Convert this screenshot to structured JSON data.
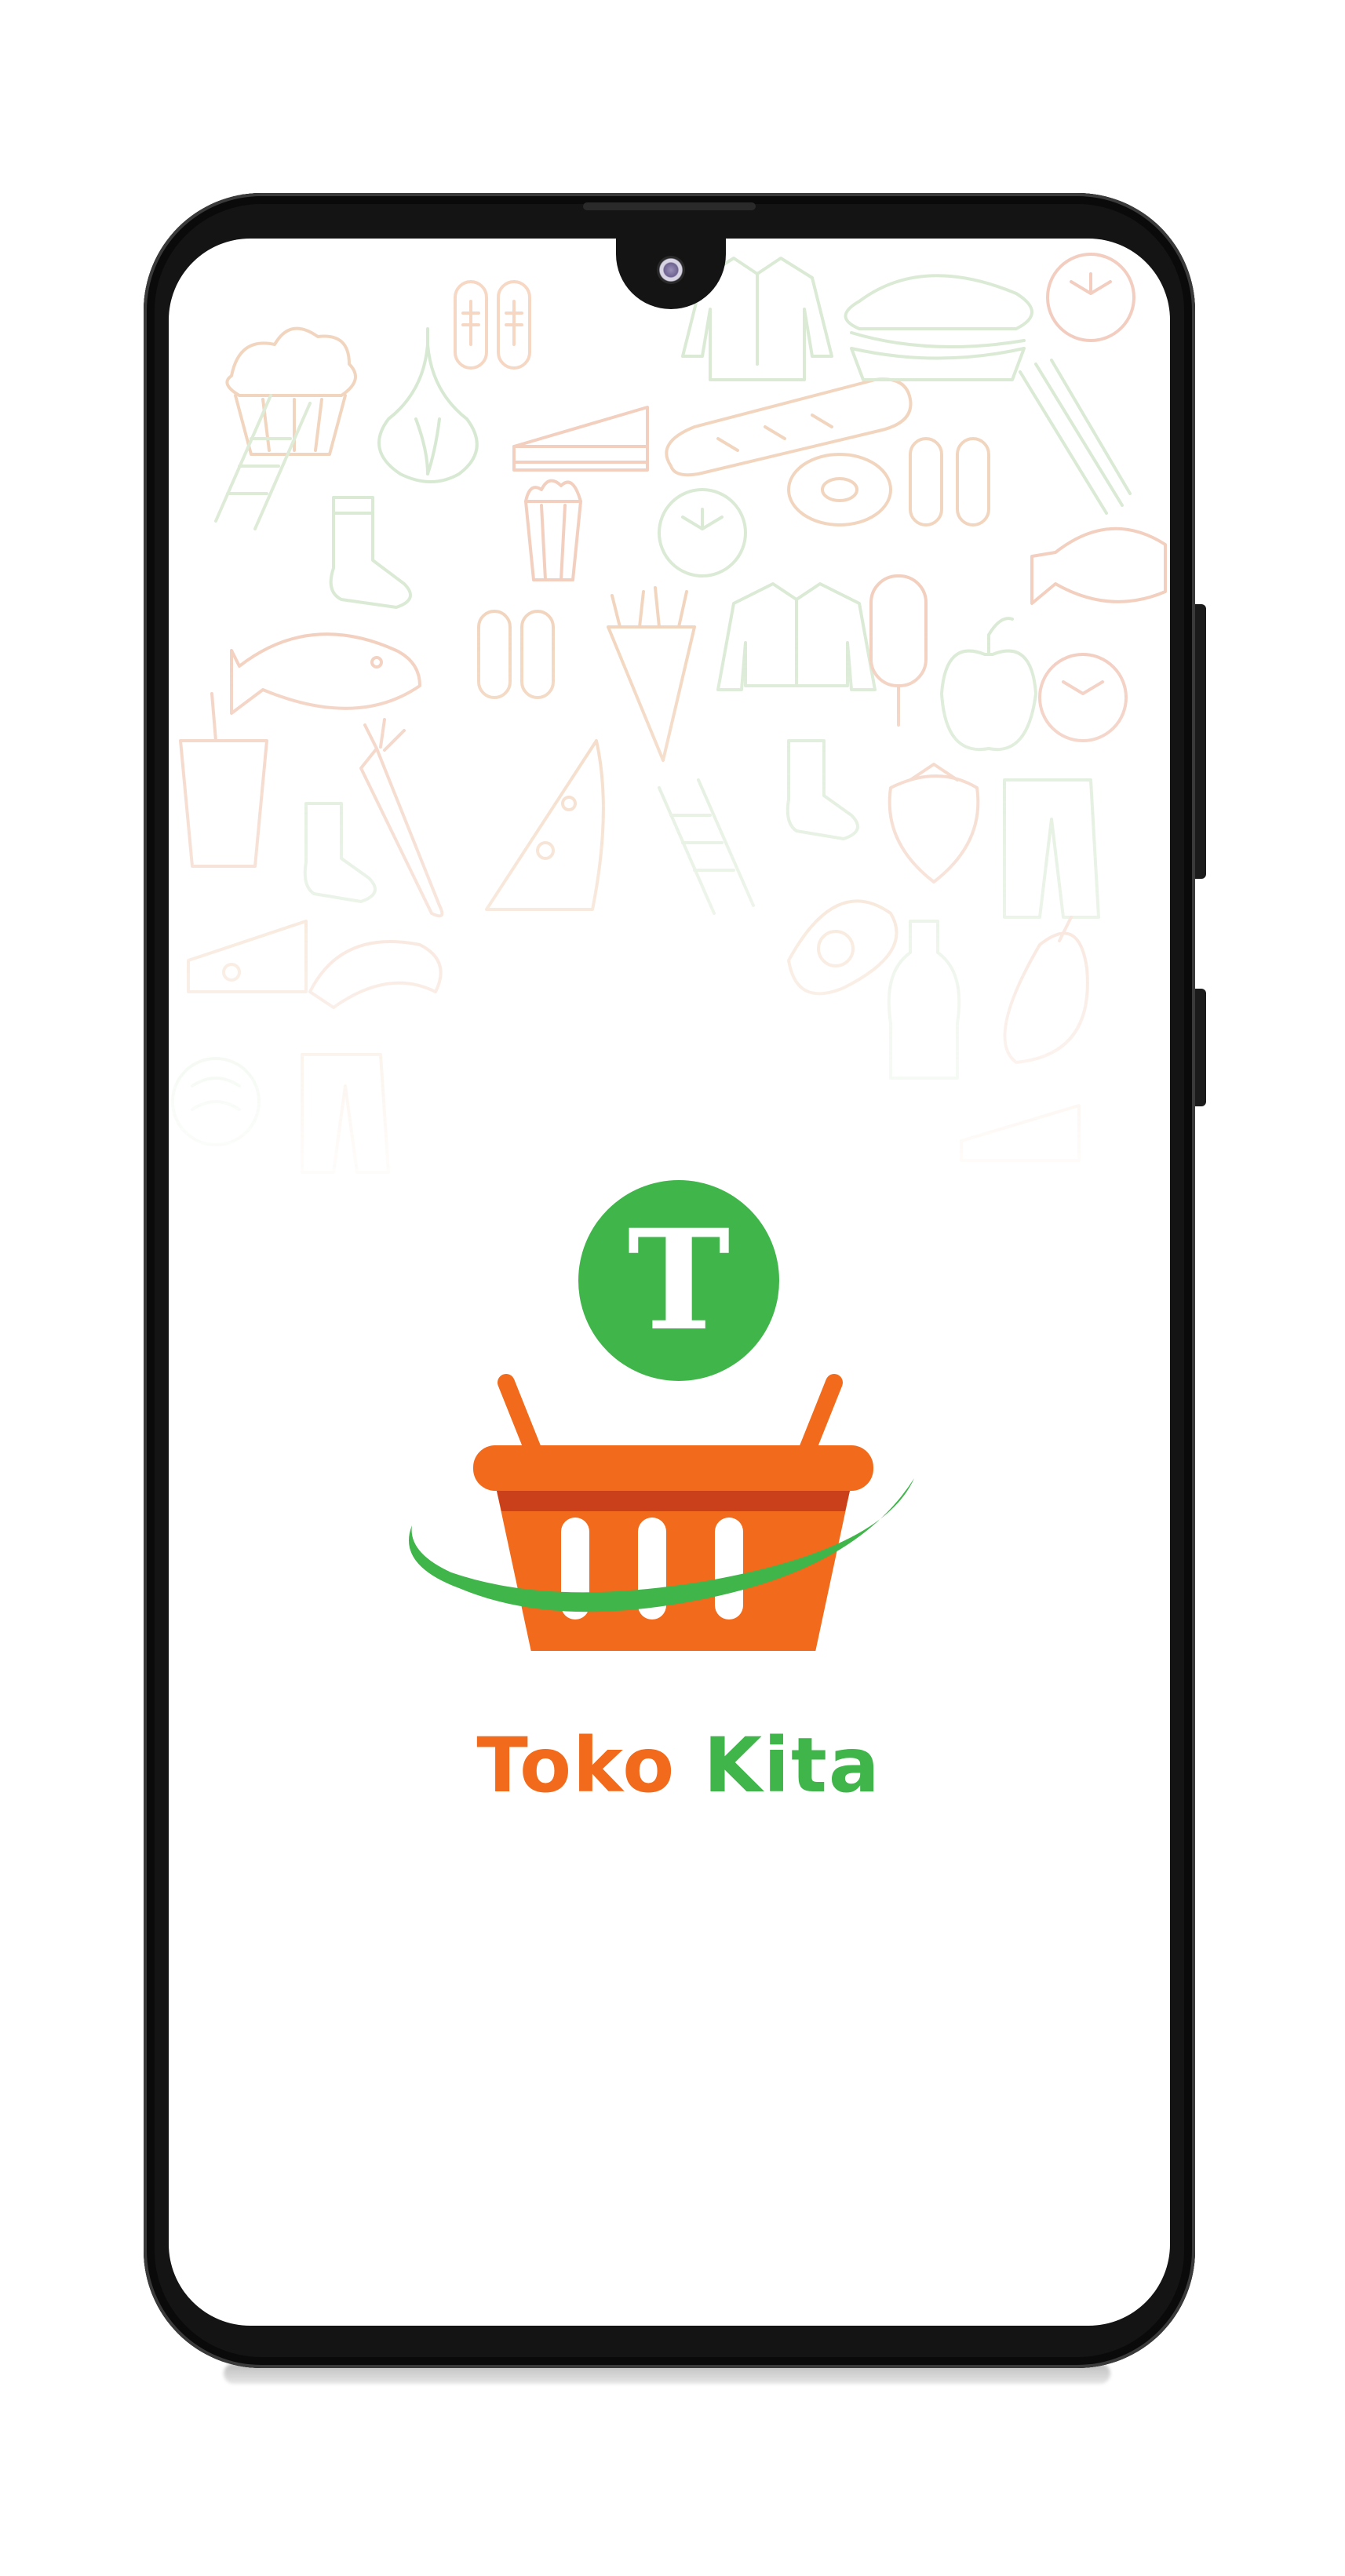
{
  "app": {
    "brand_part_1": "Toko",
    "brand_part_2": "Kita",
    "logo_letter": "T"
  },
  "colors": {
    "orange": "#f26a1b",
    "green": "#3fb54a",
    "dark_orange": "#c9401a",
    "frame": "#141414"
  },
  "icons": [
    "muffin-icon",
    "garlic-icon",
    "shoe-icon",
    "cake-slice-icon",
    "bread-icon",
    "sandwich-icon",
    "tomato-icon",
    "jacket-icon",
    "popcorn-icon",
    "donut-icon",
    "fish-icon",
    "fries-icon",
    "ice-pop-icon",
    "apple-icon",
    "pizza-icon",
    "carrot-icon",
    "sock-icon",
    "strawberry-icon",
    "pants-icon",
    "avocado-icon",
    "bottle-icon",
    "croissant-icon",
    "cheese-icon",
    "eggplant-icon",
    "drink-icon"
  ]
}
